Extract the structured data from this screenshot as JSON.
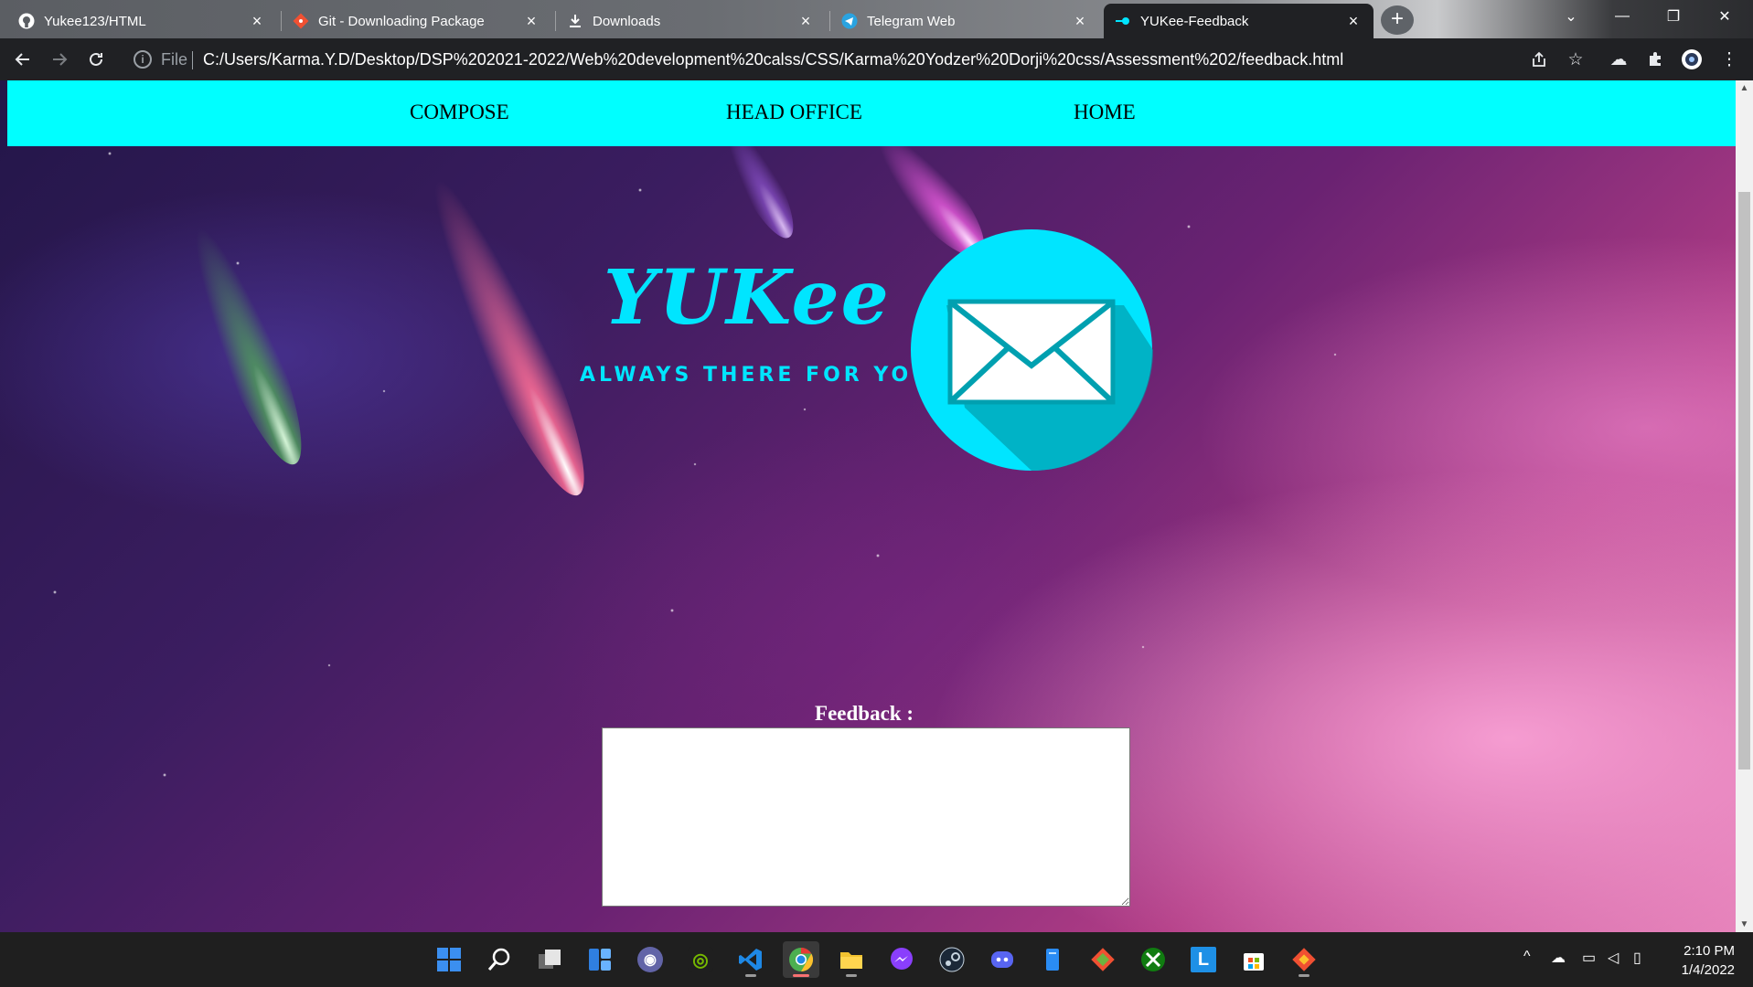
{
  "browser": {
    "tabs": [
      {
        "title": "Yukee123/HTML",
        "icon": "github-icon",
        "active": false
      },
      {
        "title": "Git - Downloading Package",
        "icon": "git-icon",
        "active": false
      },
      {
        "title": "Downloads",
        "icon": "download-icon",
        "active": false
      },
      {
        "title": "Telegram Web",
        "icon": "telegram-icon",
        "active": false
      },
      {
        "title": "YUKee-Feedback",
        "icon": "page-favicon-icon",
        "active": true
      }
    ],
    "new_tab": "+",
    "window_controls": {
      "tab_search": "⌄",
      "minimize": "—",
      "restore": "❐",
      "close": "✕"
    },
    "address": {
      "scheme_label": "File",
      "url": "C:/Users/Karma.Y.D/Desktop/DSP%202021-2022/Web%20development%20calss/CSS/Karma%20Yodzer%20Dorji%20css/Assessment%202/feedback.html"
    }
  },
  "page": {
    "nav": {
      "compose": "COMPOSE",
      "head_office": "HEAD OFFICE",
      "home": "HOME"
    },
    "logo": {
      "wordmark": "YUKee",
      "tagline": "ALWAYS THERE FOR YOU"
    },
    "feedback": {
      "label": "Feedback :",
      "value": ""
    }
  },
  "taskbar": {
    "apps": [
      {
        "name": "start-icon",
        "color": "#3b8ff0"
      },
      {
        "name": "search-icon",
        "color": "#1f1f1f"
      },
      {
        "name": "task-view-icon",
        "color": "#cfcfcf"
      },
      {
        "name": "widgets-icon",
        "color": "#2f7fe0"
      },
      {
        "name": "teams-chat-icon",
        "color": "#6264a7"
      },
      {
        "name": "nvidia-icon",
        "color": "#76b900"
      },
      {
        "name": "vscode-icon",
        "color": "#1e88e5"
      },
      {
        "name": "chrome-icon",
        "color": "#4caf50"
      },
      {
        "name": "file-explorer-icon",
        "color": "#f2c230"
      },
      {
        "name": "messenger-icon",
        "color": "#8a3ffc"
      },
      {
        "name": "steam-icon",
        "color": "#1b2838"
      },
      {
        "name": "discord-icon",
        "color": "#5865f2"
      },
      {
        "name": "notepad-icon",
        "color": "#2a8cf4"
      },
      {
        "name": "git-gui-icon",
        "color": "#f05032"
      },
      {
        "name": "xbox-icon",
        "color": "#107c10"
      },
      {
        "name": "lync-icon",
        "color": "#1e90e6"
      },
      {
        "name": "store-icon",
        "color": "#ffffff"
      },
      {
        "name": "git-bash-icon",
        "color": "#f05032"
      }
    ],
    "clock": {
      "time": "2:10 PM",
      "date": "1/4/2022"
    }
  },
  "colors": {
    "nav_bg": "#00ffff",
    "logo_accent": "#00e5ff",
    "browser_dark": "#202124"
  }
}
